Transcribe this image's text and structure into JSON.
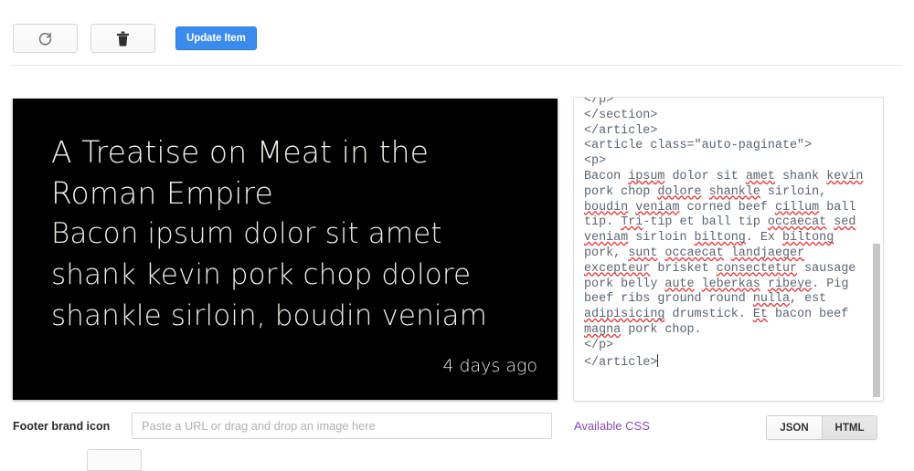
{
  "toolbar": {
    "refresh_button": {
      "icon": "refresh-icon",
      "label": ""
    },
    "delete_button": {
      "icon": "trash-icon",
      "label": ""
    },
    "update_button": {
      "label": "Update Item"
    }
  },
  "preview": {
    "title": "A Treatise on Meat in the Roman Empire",
    "body": "Bacon ipsum dolor sit amet shank kevin pork chop dolore shankle sirloin, boudin veniam",
    "timestamp": "4 days ago",
    "background_color": "#000000",
    "text_color": "#f2efe9"
  },
  "editor": {
    "mode": "HTML",
    "code": "</p>\n</section>\n</article>\n<article class=\"auto-paginate\">\n<p>\nBacon ipsum dolor sit amet shank kevin pork chop dolore shankle sirloin, boudin veniam corned beef cillum ball tip. Tri-tip et ball tip occaecat sed veniam sirloin biltong. Ex biltong pork, sunt occaecat landjaeger excepteur brisket consectetur sausage pork belly aute leberkas ribeye. Pig beef ribs ground round nulla, est adipisicing drumstick. Et bacon beef magna pork chop.\n</p>\n</article>",
    "misspelled_words": [
      "ipsum",
      "amet",
      "kevin",
      "dolore",
      "shankle",
      "boudin",
      "veniam",
      "cillum",
      "Tri",
      "occaecat",
      "sed",
      "biltong",
      "sunt",
      "landjaeger",
      "excepteur",
      "consectetur",
      "aute",
      "leberkas",
      "ribeye",
      "nulla",
      "adipisicing",
      "Et",
      "magna"
    ],
    "spellcheck_underline_color": "#e8393c",
    "text_color": "#5a6470"
  },
  "form": {
    "footer_icon_label": "Footer brand icon",
    "url_input_value": "",
    "url_input_placeholder": "Paste a URL or drag and drop an image here"
  },
  "footer": {
    "css_link": "Available CSS",
    "css_link_color": "#8b4ab8",
    "segments": [
      {
        "label": "JSON",
        "active": false
      },
      {
        "label": "HTML",
        "active": true
      }
    ]
  }
}
